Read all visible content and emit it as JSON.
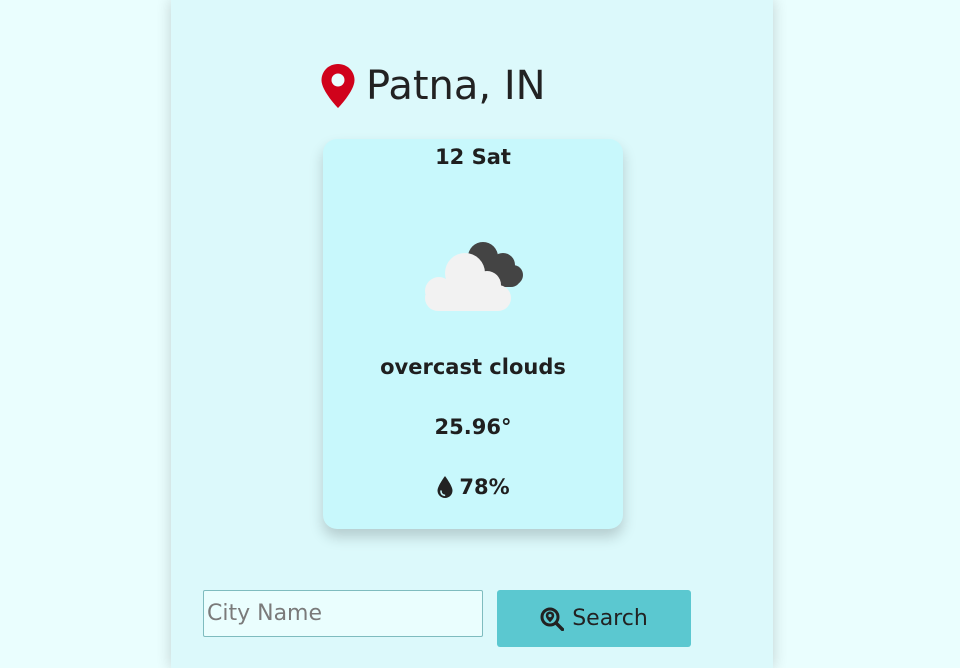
{
  "location": {
    "city": "Patna, IN",
    "icon": "map-pin-icon"
  },
  "card": {
    "date": "12 Sat",
    "weather_icon": "overcast-clouds-icon",
    "description": "overcast clouds",
    "temperature": "25.96°",
    "humidity": "78%",
    "humidity_icon": "water-drop-icon"
  },
  "search": {
    "placeholder": "City Name",
    "value": "",
    "button_label": "Search",
    "button_icon": "search-location-icon"
  },
  "colors": {
    "page_bg": "#eafefe",
    "panel_bg": "#dcf9fb",
    "card_bg": "#c8f8fc",
    "button_bg": "#5bc8d0",
    "pin": "#d0021b"
  }
}
